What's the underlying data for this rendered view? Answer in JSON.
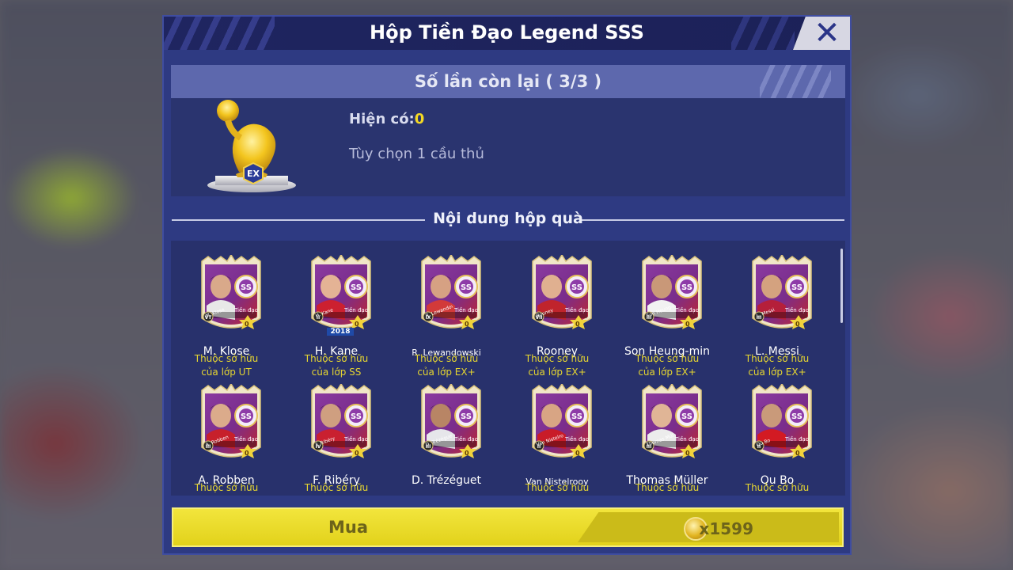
{
  "dialog": {
    "title": "Hộp Tiền Đạo Legend SSS",
    "close_icon": "close-x-icon"
  },
  "info": {
    "remaining_label": "Số lần còn lại ( 3/3 )",
    "available_label": "Hiện có:",
    "available_value": "0",
    "option_text": "Tùy chọn 1 cầu thủ",
    "trophy_icon": "gold-trophy-icon",
    "trophy_badge": "EX"
  },
  "contents": {
    "section_title": "Nội dung hộp quà",
    "players": [
      {
        "name": "M. Klose",
        "owner1": "Thuộc sở hữu",
        "owner2": "của lớp UT",
        "card_name": "M. Klose",
        "season": "VT",
        "position": "Tiền đạo",
        "level": "0"
      },
      {
        "name": "H. Kane",
        "owner1": "Thuộc sở hữu",
        "owner2": "của lớp SS",
        "card_name": "H. Kane",
        "season": "II",
        "position": "Tiền đạo",
        "level": "0",
        "year": "2018"
      },
      {
        "name": "R. Lewandowski",
        "owner1": "Thuộc sở hữu",
        "owner2": "của lớp EX+",
        "card_name": "R. Lewandowski",
        "season": "IX",
        "position": "Tiền đạo",
        "level": "0"
      },
      {
        "name": "Rooney",
        "owner1": "Thuộc sở hữu",
        "owner2": "của lớp EX+",
        "card_name": "Rooney",
        "season": "VII",
        "position": "Tiền đạo",
        "level": "0"
      },
      {
        "name": "Son Heung-min",
        "owner1": "Thuộc sở hữu",
        "owner2": "của lớp EX+",
        "card_name": "Son Heung-min",
        "season": "III",
        "position": "Tiền đạo",
        "level": "0"
      },
      {
        "name": "L. Messi",
        "owner1": "Thuộc sở hữu",
        "owner2": "của lớp EX+",
        "card_name": "L. Messi",
        "season": "III",
        "position": "Tiền đạo",
        "level": "0"
      },
      {
        "name": "A. Robben",
        "owner1": "Thuộc sở hữu",
        "owner2": "",
        "card_name": "A. Robben",
        "season": "III",
        "position": "Tiền đạo",
        "level": "0"
      },
      {
        "name": "F. Ribéry",
        "owner1": "Thuộc sở hữu",
        "owner2": "",
        "card_name": "F. Ribéry",
        "season": "IV",
        "position": "Tiền đạo",
        "level": "0"
      },
      {
        "name": "D. Trézéguet",
        "owner1": "",
        "owner2": "",
        "card_name": "D. Trézéguet",
        "season": "III",
        "position": "Tiền đạo",
        "level": "0"
      },
      {
        "name": "Van Nistelrooy",
        "owner1": "Thuộc sở hữu",
        "owner2": "",
        "card_name": "Van Nistelrooy",
        "season": "II",
        "position": "Tiền đạo",
        "level": "0"
      },
      {
        "name": "Thomas Müller",
        "owner1": "Thuộc sở hữu",
        "owner2": "",
        "card_name": "Thomas Müller",
        "season": "III",
        "position": "Tiền đạo",
        "level": "0"
      },
      {
        "name": "Qu Bo",
        "owner1": "Thuộc sở hữu",
        "owner2": "",
        "card_name": "Qu Bo",
        "season": "II",
        "position": "Tiền đạo",
        "level": "0"
      }
    ]
  },
  "buy": {
    "label": "Mua",
    "price": "x1599",
    "coin_icon": "gold-coin-icon"
  },
  "colors": {
    "panel": "#2e3a82",
    "accent_yellow": "#f5d923",
    "card_purple": "#7a2d8c",
    "card_red": "#c0262e"
  }
}
